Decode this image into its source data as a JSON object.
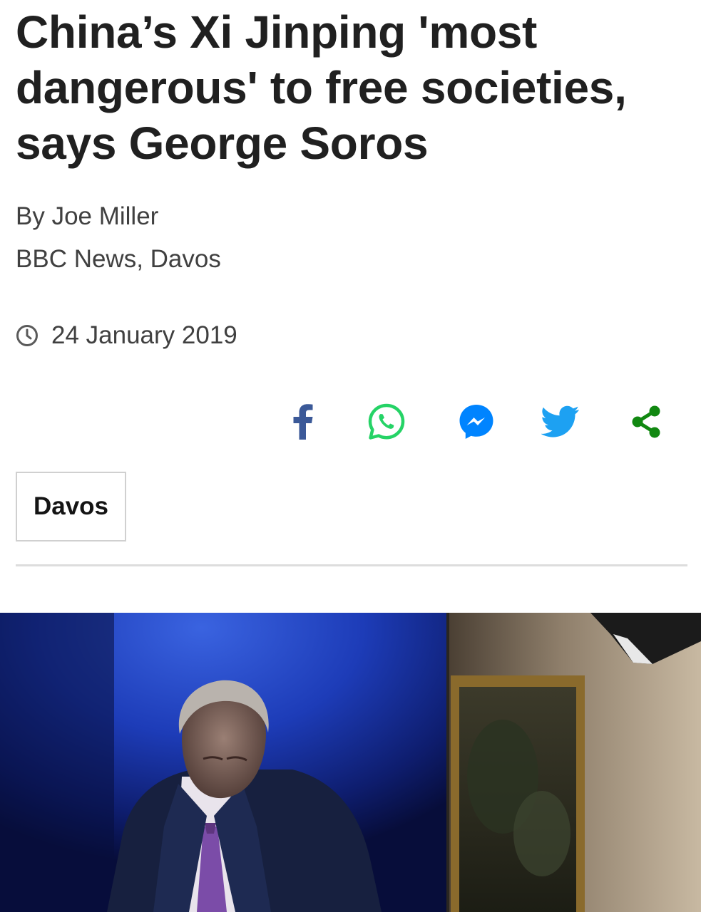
{
  "article": {
    "headline": "China’s Xi Jinping 'most dangerous' to free societies, says George Soros",
    "byline": "By Joe Miller",
    "organization": "BBC News, Davos",
    "date": "24 January 2019",
    "tag": "Davos"
  },
  "share": {
    "buttons": [
      {
        "name": "facebook",
        "icon": "facebook-icon",
        "color": "#3b5998"
      },
      {
        "name": "whatsapp",
        "icon": "whatsapp-icon",
        "color": "#25d366"
      },
      {
        "name": "messenger",
        "icon": "messenger-icon",
        "color": "#0084ff"
      },
      {
        "name": "twitter",
        "icon": "twitter-icon",
        "color": "#1da1f2"
      },
      {
        "name": "share",
        "icon": "share-icon",
        "color": "#118811"
      }
    ]
  },
  "colors": {
    "headline": "#202020",
    "meta_text": "#404040",
    "divider": "#dddddd",
    "tag_border": "#d0d0d0"
  }
}
